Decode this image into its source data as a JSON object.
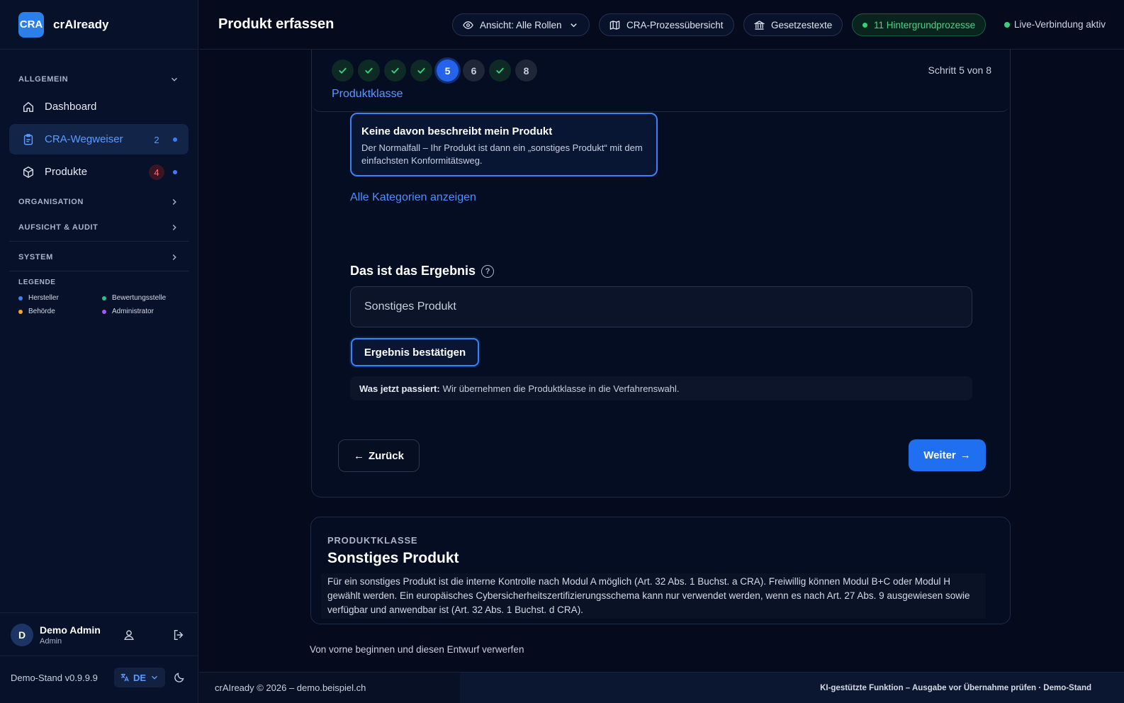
{
  "brand": {
    "logo": "CRA",
    "name": "crAIready"
  },
  "sidebar": {
    "sections": {
      "allgemein": "ALLGEMEIN",
      "organisation": "ORGANISATION",
      "aufsicht": "AUFSICHT & AUDIT",
      "system": "SYSTEM"
    },
    "items": [
      {
        "label": "Dashboard",
        "icon": "home-icon"
      },
      {
        "label": "CRA-Wegweiser",
        "count": "2",
        "icon": "clipboard-icon",
        "active": true
      },
      {
        "label": "Produkte",
        "count": "4",
        "icon": "package-icon"
      }
    ],
    "legend": {
      "title": "LEGENDE",
      "items": [
        {
          "label": "Hersteller",
          "color": "#3b82f6"
        },
        {
          "label": "Bewertungsstelle",
          "color": "#22c58b"
        },
        {
          "label": "Behörde",
          "color": "#f5a524"
        },
        {
          "label": "Administrator",
          "color": "#a855f7"
        }
      ]
    },
    "user": {
      "initial": "D",
      "name": "Demo Admin",
      "role": "Admin"
    },
    "version": "Demo-Stand v0.9.9.9",
    "language": "DE"
  },
  "topbar": {
    "title": "Produkt erfassen",
    "view_label": "Ansicht: Alle Rollen",
    "process_overview": "CRA-Prozessübersicht",
    "law_texts": "Gesetzestexte",
    "background_jobs": "11 Hintergrundprozesse",
    "live_status": "Live-Verbindung aktiv"
  },
  "wizard": {
    "steps": [
      {
        "label": "",
        "state": "done"
      },
      {
        "label": "",
        "state": "done"
      },
      {
        "label": "",
        "state": "done"
      },
      {
        "label": "",
        "state": "done"
      },
      {
        "label": "5",
        "state": "current"
      },
      {
        "label": "6",
        "state": "pending"
      },
      {
        "label": "",
        "state": "done"
      },
      {
        "label": "8",
        "state": "pending"
      }
    ],
    "step_label": "Produktklasse",
    "step_count": "Schritt 5 von 8",
    "option": {
      "title": "Keine davon beschreibt mein Produkt",
      "description": "Der Normalfall – Ihr Produkt ist dann ein „sonstiges Produkt“ mit dem einfachsten Konformitätsweg."
    },
    "show_all_link": "Alle Kategorien anzeigen",
    "result_heading": "Das ist das Ergebnis",
    "result_value": "Sonstiges Produkt",
    "confirm_button": "Ergebnis bestätigen",
    "info_bold": "Was jetzt passiert:",
    "info_text": "Wir übernehmen die Produktklasse in die Verfahrenswahl.",
    "back_button": "Zurück",
    "next_button": "Weiter"
  },
  "product_class": {
    "kicker": "PRODUKTKLASSE",
    "title": "Sonstiges Produkt",
    "text": "Für ein sonstiges Produkt ist die interne Kontrolle nach Modul A möglich (Art. 32 Abs. 1 Buchst. a CRA). Freiwillig können Modul B+C oder Modul H gewählt werden. Ein europäisches Cybersicherheitszertifizierungsschema kann nur verwendet werden, wenn es nach Art. 27 Abs. 9 ausgewiesen sowie verfügbar und anwendbar ist (Art. 32 Abs. 1 Buchst. d CRA)."
  },
  "restart_link": "Von vorne beginnen und diesen Entwurf verwerfen",
  "footer": {
    "left": "crAIready © 2026 – demo.beispiel.ch",
    "right": "KI-gestützte Funktion – Ausgabe vor Übernahme prüfen · Demo-Stand"
  }
}
